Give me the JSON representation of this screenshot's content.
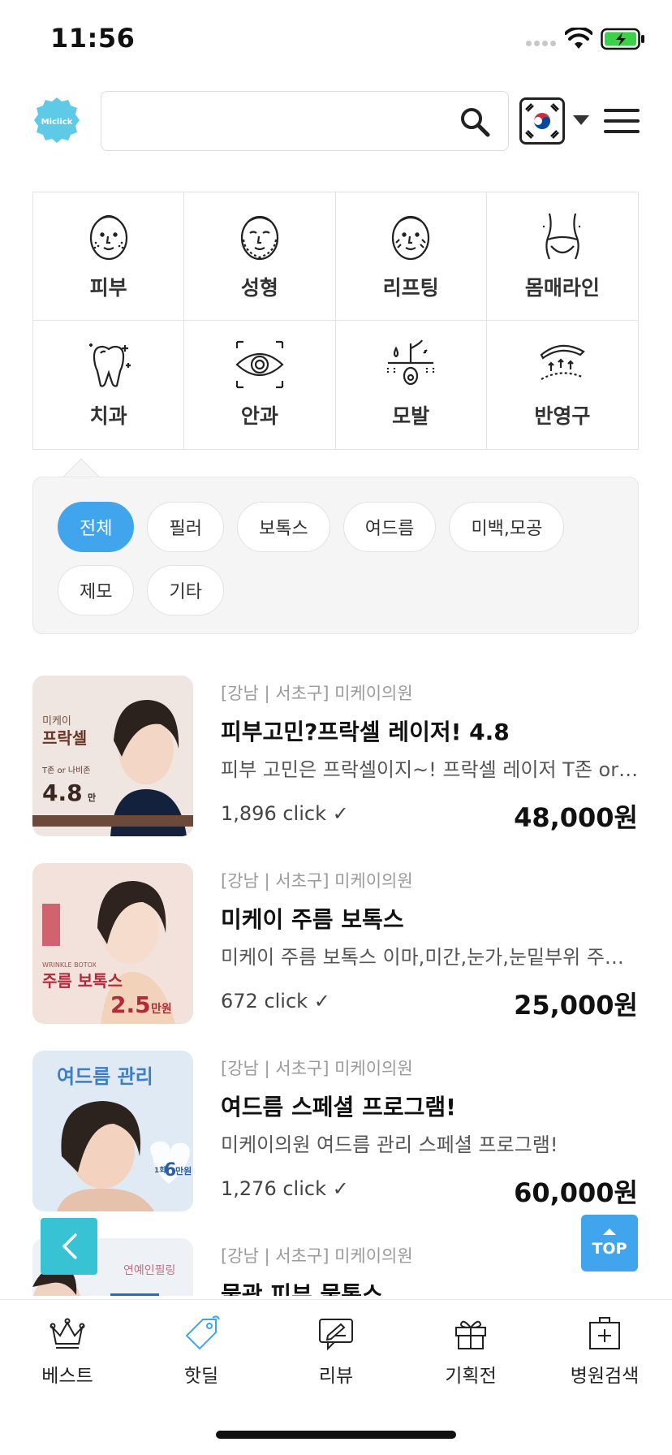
{
  "status_bar": {
    "time": "11:56"
  },
  "header": {
    "logo_text": "Miclick",
    "search_placeholder": "",
    "search_value": ""
  },
  "categories": [
    {
      "label": "피부",
      "icon": "skin-face-icon"
    },
    {
      "label": "성형",
      "icon": "plastic-surgery-face-icon"
    },
    {
      "label": "리프팅",
      "icon": "lifting-face-icon"
    },
    {
      "label": "몸매라인",
      "icon": "body-line-icon"
    },
    {
      "label": "치과",
      "icon": "tooth-icon"
    },
    {
      "label": "안과",
      "icon": "eye-icon"
    },
    {
      "label": "모발",
      "icon": "hair-follicle-icon"
    },
    {
      "label": "반영구",
      "icon": "eyebrow-icon"
    }
  ],
  "subcategories": {
    "active": "전체",
    "items": [
      "전체",
      "필러",
      "보톡스",
      "여드름",
      "미백,모공",
      "제모",
      "기타"
    ]
  },
  "deals": [
    {
      "location": "[강남 | 서초구] 미케이의원",
      "title": "피부고민?프락셀 레이저! 4.8",
      "description": "피부 고민은 프락셀이지~! 프락셀 레이저 T존 or 나비존 부위",
      "clicks": "1,896  click ✓",
      "price": "48,000원",
      "thumb": {
        "line1": "미케이",
        "line2": "프락셀",
        "line3": "T존 or 나비존",
        "price": "4.8",
        "unit": "만"
      }
    },
    {
      "location": "[강남 | 서초구] 미케이의원",
      "title": "미케이 주름 보톡스",
      "description": "미케이 주름 보톡스 이마,미간,눈가,눈밑부위 주름 개선",
      "clicks": "672  click ✓",
      "price": "25,000원",
      "thumb": {
        "line1": "WRINKLE BOTOX",
        "line2": "주름 보톡스",
        "price": "2.5",
        "unit": "만원"
      }
    },
    {
      "location": "[강남 | 서초구] 미케이의원",
      "title": "여드름 스페셜 프로그램!",
      "description": "미케이의원 여드름 관리 스페셜 프로그램!",
      "clicks": "1,276  click ✓",
      "price": "60,000원",
      "thumb": {
        "line1": "여드름 관리",
        "line2": "1회",
        "price": "6",
        "unit": "만원"
      }
    },
    {
      "location": "[강남 | 서초구] 미케이의원",
      "title": "물광 피부 물톡스",
      "description": "",
      "clicks": "",
      "price": "",
      "thumb": {
        "line1": "연예인필링"
      }
    }
  ],
  "floating": {
    "top_label": "TOP"
  },
  "bottom_nav": [
    {
      "label": "베스트",
      "icon": "crown-icon"
    },
    {
      "label": "핫딜",
      "icon": "tag-icon"
    },
    {
      "label": "리뷰",
      "icon": "review-icon"
    },
    {
      "label": "기획전",
      "icon": "gift-icon"
    },
    {
      "label": "병원검색",
      "icon": "hospital-icon"
    }
  ],
  "colors": {
    "accent": "#41a5ee",
    "back_button": "#37c3d4",
    "logo": "#5fc9e8"
  }
}
